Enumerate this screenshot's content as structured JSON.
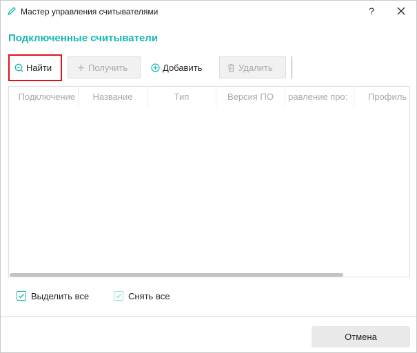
{
  "window": {
    "title": "Мастер управления считывателями",
    "help_label": "?",
    "accent_color": "#16b7b2",
    "highlight_color": "#e0101e"
  },
  "section": {
    "title": "Подключенные считыватели"
  },
  "toolbar": {
    "find_label": "Найти",
    "get_label": "Получить",
    "add_label": "Добавить",
    "delete_label": "Удалить"
  },
  "table": {
    "columns": [
      "Подключение",
      "Название",
      "Тип",
      "Версия ПО",
      "равление про:",
      "Профиль"
    ],
    "rows": []
  },
  "selection": {
    "select_all_label": "Выделить все",
    "deselect_all_label": "Снять все"
  },
  "footer": {
    "cancel_label": "Отмена"
  },
  "icons": {
    "app": "pencil-icon",
    "find": "search-icon",
    "get": "plus-icon",
    "add": "plus-circle-icon",
    "delete": "trash-icon",
    "close": "close-icon",
    "checkbox": "checkmark-icon"
  }
}
